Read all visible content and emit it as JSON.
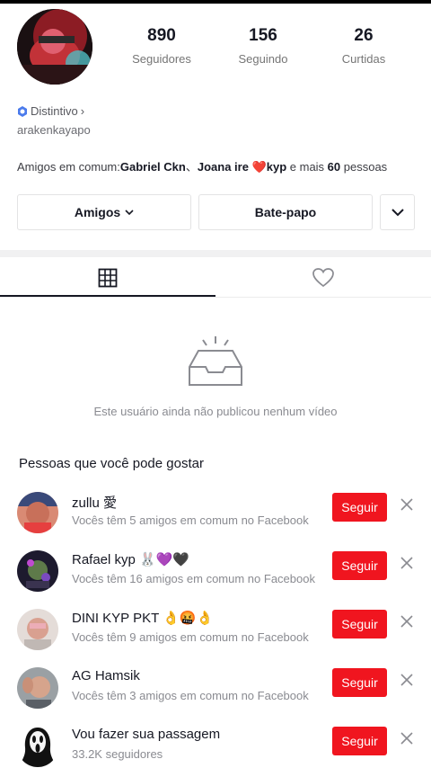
{
  "profile": {
    "stats": [
      {
        "value": "890",
        "label": "Seguidores"
      },
      {
        "value": "156",
        "label": "Seguindo"
      },
      {
        "value": "26",
        "label": "Curtidas"
      }
    ],
    "badge_label": "Distintivo",
    "badge_chevron": "›",
    "username": "arakenkayapo",
    "mutual_prefix": "Amigos em comum:",
    "mutual_name1": "Gabriel Ckn",
    "mutual_sep": "、",
    "mutual_name2": "Joana ire ❤️kyp",
    "mutual_middle": " e mais ",
    "mutual_count": "60",
    "mutual_suffix": " pessoas"
  },
  "actions": {
    "friends_label": "Amigos",
    "chat_label": "Bate-papo"
  },
  "tabs": {
    "videos_icon": "grid-icon",
    "liked_icon": "heart-icon"
  },
  "empty_state": {
    "icon": "empty-inbox-icon",
    "message": "Este usuário ainda não publicou nenhum vídeo"
  },
  "suggestions": {
    "title": "Pessoas que você pode gostar",
    "follow_label": "Seguir",
    "items": [
      {
        "name": "zullu 愛",
        "subtitle": "Vocês têm 5 amigos em comum no Facebook"
      },
      {
        "name": "Rafael kyp 🐰💜🖤",
        "subtitle": "Vocês têm 16 amigos em comum no Facebook"
      },
      {
        "name": "DINI KYP PKT 👌🤬👌",
        "subtitle": "Vocês têm 9 amigos em comum no Facebook"
      },
      {
        "name": "AG Hamsik",
        "subtitle": "Vocês têm 3 amigos em comum no Facebook"
      },
      {
        "name": "Vou fazer sua passagem",
        "subtitle": "33.2K seguidores"
      }
    ]
  },
  "colors": {
    "follow_button": "#f0151f",
    "text_primary": "#161823",
    "text_secondary": "#8a8b91",
    "badge_blue": "#4b7bec"
  }
}
